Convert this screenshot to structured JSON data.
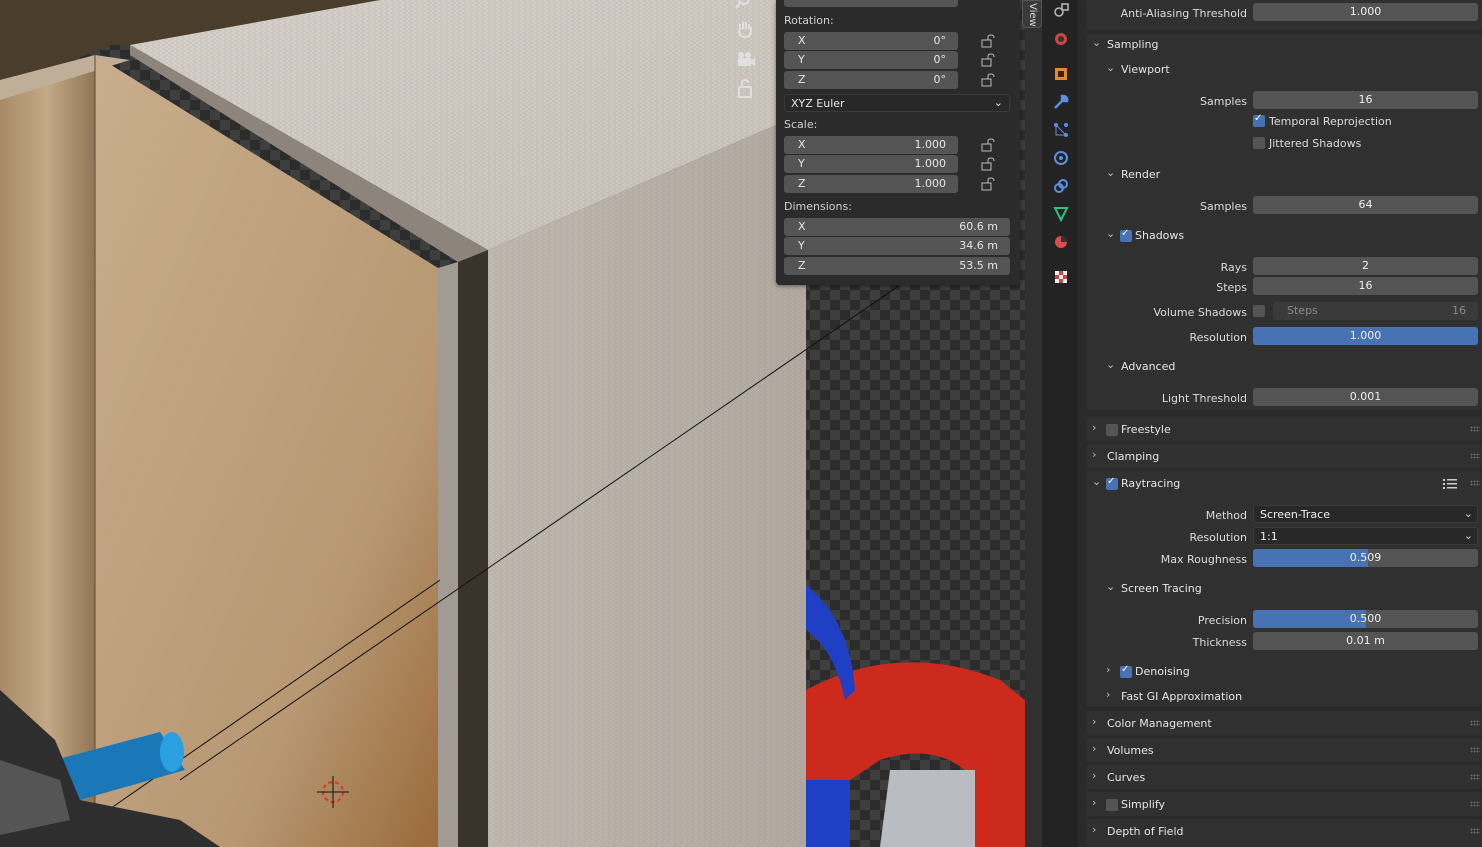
{
  "transform": {
    "rotation_label": "Rotation:",
    "rotation": [
      {
        "axis": "X",
        "value": "0°"
      },
      {
        "axis": "Y",
        "value": "0°"
      },
      {
        "axis": "Z",
        "value": "0°"
      }
    ],
    "rotation_mode": "XYZ Euler",
    "scale_label": "Scale:",
    "scale": [
      {
        "axis": "X",
        "value": "1.000"
      },
      {
        "axis": "Y",
        "value": "1.000"
      },
      {
        "axis": "Z",
        "value": "1.000"
      }
    ],
    "dimensions_label": "Dimensions:",
    "dimensions": [
      {
        "axis": "X",
        "value": "60.6 m"
      },
      {
        "axis": "Y",
        "value": "34.6 m"
      },
      {
        "axis": "Z",
        "value": "53.5 m"
      }
    ]
  },
  "viewport": {
    "n_tab_label": "View",
    "gizmos": [
      "zoom-icon",
      "hand-pan-icon",
      "camera-view-icon",
      "lock-icon"
    ]
  },
  "property_tabs": [
    "tool-icon",
    "world-icon",
    "object-icon",
    "modifier-icon",
    "particles-icon",
    "physics-icon",
    "constraints-icon",
    "data-icon",
    "material-icon",
    "texture-icon"
  ],
  "properties": {
    "aa_threshold": {
      "label": "Anti-Aliasing Threshold",
      "value": "1.000"
    },
    "sampling": {
      "title": "Sampling",
      "viewport": {
        "title": "Viewport",
        "samples_label": "Samples",
        "samples": "16",
        "temporal": "Temporal Reprojection",
        "temporal_checked": true,
        "jittered": "Jittered Shadows",
        "jittered_checked": false
      },
      "render": {
        "title": "Render",
        "samples_label": "Samples",
        "samples": "64"
      },
      "shadows": {
        "title": "Shadows",
        "checked": true,
        "rays_label": "Rays",
        "rays": "2",
        "steps_label": "Steps",
        "steps": "16",
        "volume_label": "Volume Shadows",
        "volume_steps_label": "Steps",
        "volume_steps": "16",
        "resolution_label": "Resolution",
        "resolution": "1.000",
        "resolution_fraction": 1.0
      },
      "advanced": {
        "title": "Advanced",
        "light_threshold_label": "Light Threshold",
        "light_threshold": "0.001"
      }
    },
    "freestyle": {
      "title": "Freestyle",
      "checked": false
    },
    "clamping": {
      "title": "Clamping"
    },
    "raytracing": {
      "title": "Raytracing",
      "checked": true,
      "method_label": "Method",
      "method": "Screen-Trace",
      "resolution_label": "Resolution",
      "resolution": "1:1",
      "max_roughness_label": "Max Roughness",
      "max_roughness": "0.509",
      "max_roughness_fraction": 0.509,
      "screen_tracing": {
        "title": "Screen Tracing",
        "precision_label": "Precision",
        "precision": "0.500",
        "precision_fraction": 0.5,
        "thickness_label": "Thickness",
        "thickness": "0.01 m"
      },
      "denoising": {
        "title": "Denoising",
        "checked": true
      },
      "fast_gi": {
        "title": "Fast GI Approximation"
      }
    },
    "color_management": {
      "title": "Color Management"
    },
    "volumes": {
      "title": "Volumes"
    },
    "curves": {
      "title": "Curves"
    },
    "simplify": {
      "title": "Simplify",
      "checked": false
    },
    "dof": {
      "title": "Depth of Field"
    }
  }
}
